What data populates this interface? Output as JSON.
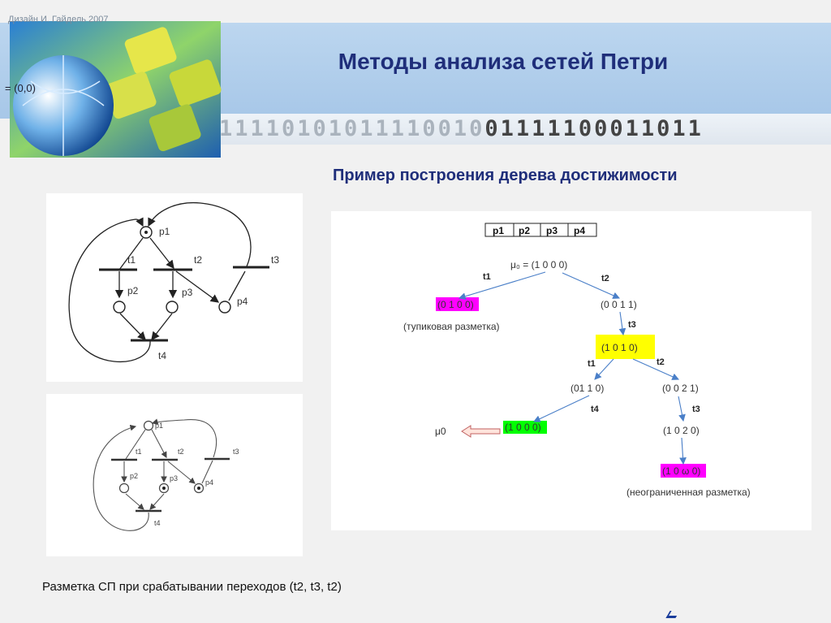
{
  "header": {
    "title": "Методы анализа сетей Петри",
    "logo_credit": "Дизайн И. Гайдель 2007",
    "logo_formula": "= (0,0)",
    "binary_dark": "11110101011110010",
    "binary_light": "01111100011011"
  },
  "subtitle": "Пример построения дерева достижимости",
  "caption": "Разметка СП при срабатывании переходов (t2, t3, t2)",
  "net1": {
    "places": [
      "p1",
      "p2",
      "p3",
      "p4"
    ],
    "transitions": [
      "t1",
      "t2",
      "t3",
      "t4"
    ]
  },
  "net2": {
    "places": [
      "p1",
      "p2",
      "p3",
      "p4"
    ],
    "transitions": [
      "t1",
      "t2",
      "t3",
      "t4"
    ]
  },
  "tree": {
    "header_cells": [
      "p1",
      "p2",
      "p3",
      "p4"
    ],
    "root": "μ₀ = (1 0 0 0)",
    "n_dead": "(0 1 0 0)",
    "dead_note": "(тупиковая разметка)",
    "n_0011": "(0 0 1 1)",
    "n_1010": "(1 0 1 0)",
    "n_0110": "(01 1 0)",
    "n_0021": "(0 0 2 1)",
    "n_1000": "(1 0 0 0)",
    "mu0": "μ0",
    "n_1020": "(1 0 2 0)",
    "n_omega": "(1 0 ω 0)",
    "omega_note": "(неограниченная разметка)",
    "edge_labels": {
      "root_t1": "t1",
      "root_t2": "t2",
      "a_t3": "t3",
      "b_t1": "t1",
      "b_t2": "t2",
      "c_t4": "t4",
      "d_t3": "t3",
      "e_t3": "t3"
    },
    "colors": {
      "dead": "#ff00ff",
      "yellow": "#ffff00",
      "green": "#00ff00",
      "arrow": "#4a7fc8"
    }
  }
}
